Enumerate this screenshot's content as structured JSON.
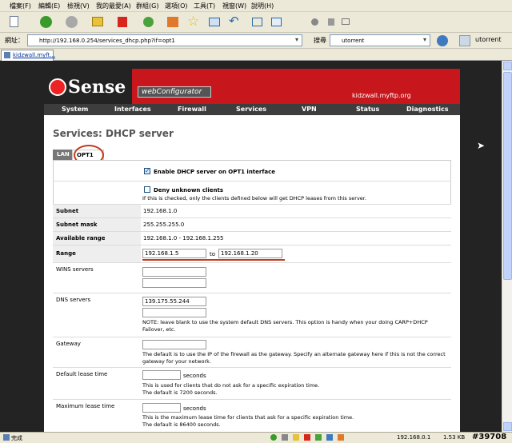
{
  "menu": [
    "檔案(F)",
    "編輯(E)",
    "檢視(V)",
    "我的最愛(A)",
    "群組(G)",
    "選項(O)",
    "工具(T)",
    "視窗(W)",
    "說明(H)"
  ],
  "address": {
    "label": "網址：",
    "url": "http://192.168.0.254/services_dhcp.php?if=opt1"
  },
  "search": {
    "label": "搜尋",
    "query": "utorrent",
    "button": "utorrent"
  },
  "tab": {
    "title": "kidzwall.myft..."
  },
  "header": {
    "logo": "Sense",
    "subtitle": "webConfigurator",
    "hostname": "kidzwall.myftp.org"
  },
  "nav": [
    "System",
    "Interfaces",
    "Firewall",
    "Services",
    "VPN",
    "Status",
    "Diagnostics"
  ],
  "page": {
    "title": "Services: DHCP server",
    "tabs": [
      "LAN",
      "OPT1"
    ],
    "enable_label": "Enable DHCP server on OPT1 interface",
    "deny_label": "Deny unknown clients",
    "deny_note": "If this is checked, only the clients defined below will get DHCP leases from this server.",
    "subnet_label": "Subnet",
    "subnet": "192.168.1.0",
    "mask_label": "Subnet mask",
    "mask": "255.255.255.0",
    "avail_label": "Available range",
    "avail": "192.168.1.0 - 192.168.1.255",
    "range_label": "Range",
    "range_from": "192.168.1.5",
    "range_to_label": "to",
    "range_to": "192.168.1.20",
    "wins_label": "WINS servers",
    "dns_label": "DNS servers",
    "dns1": "139.175.55.244",
    "dns_note": "NOTE: leave blank to use the system default DNS servers. This option is handy when your doing CARP+DHCP Failover, etc.",
    "gw_label": "Gateway",
    "gw_note": "The default is to use the IP of the firewall as the gateway. Specify an alternate gateway here if this is not the correct gateway for your network.",
    "dlt_label": "Default lease time",
    "seconds": "seconds",
    "dlt_note1": "This is used for clients that do not ask for a specific expiration time.",
    "dlt_note2": "The default is 7200 seconds.",
    "mlt_label": "Maximum lease time",
    "mlt_note1": "This is the maximum lease time for clients that ask for a specific expiration time.",
    "mlt_note2": "The default is 86400 seconds."
  },
  "status": {
    "left": "完成",
    "ip": "192.168.0.1",
    "size": "1.53 KB",
    "watermark": "#39708"
  }
}
